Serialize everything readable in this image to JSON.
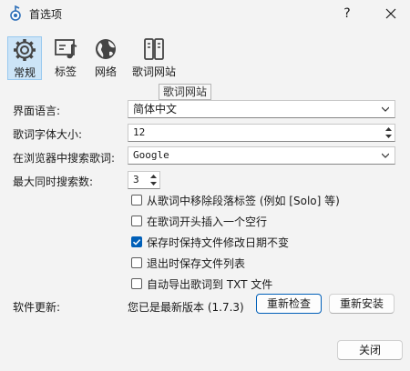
{
  "window": {
    "title": "首选项",
    "help_label": "?"
  },
  "toolbar": {
    "items": [
      {
        "label": "常规",
        "icon": "gear-icon",
        "active": true
      },
      {
        "label": "标签",
        "icon": "music-note-icon",
        "active": false
      },
      {
        "label": "网络",
        "icon": "globe-icon",
        "active": false
      },
      {
        "label": "歌词网站",
        "icon": "books-icon",
        "active": false
      }
    ],
    "tooltip": "歌词网站"
  },
  "form": {
    "language_label": "界面语言:",
    "language_value": "简体中文",
    "font_size_label": "歌词字体大小:",
    "font_size_value": "12",
    "search_label": "在浏览器中搜索歌词:",
    "search_value": "Google",
    "max_search_label": "最大同时搜索数:",
    "max_search_value": "3"
  },
  "options": [
    {
      "label": "从歌词中移除段落标签 (例如 [Solo] 等)",
      "checked": false
    },
    {
      "label": "在歌词开头插入一个空行",
      "checked": false
    },
    {
      "label": "保存时保持文件修改日期不变",
      "checked": true
    },
    {
      "label": "退出时保存文件列表",
      "checked": false
    },
    {
      "label": "自动导出歌词到 TXT 文件",
      "checked": false
    }
  ],
  "update": {
    "label": "软件更新:",
    "status": "您已是最新版本 (1.7.3)",
    "check_button": "重新检查",
    "reinstall_button": "重新安装"
  },
  "footer": {
    "close_button": "关闭"
  },
  "colors": {
    "accent": "#005fb8",
    "active_tab_bg": "#cce4f7"
  }
}
